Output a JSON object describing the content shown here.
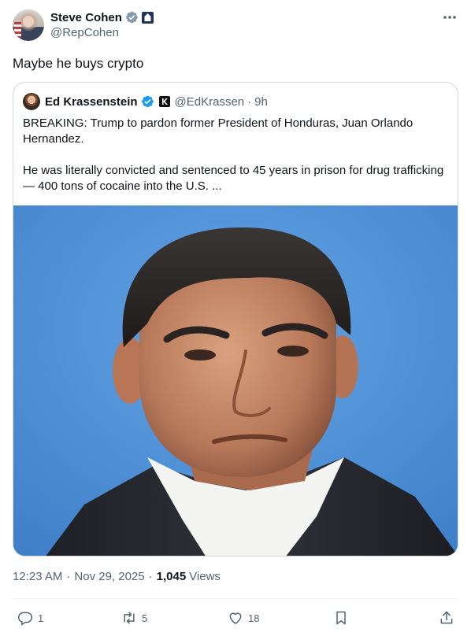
{
  "author": {
    "display_name": "Steve Cohen",
    "handle": "@RepCohen"
  },
  "tweet": {
    "text": "Maybe he buys crypto"
  },
  "quote": {
    "display_name": "Ed Krassenstein",
    "handle": "@EdKrassen",
    "separator": "·",
    "time": "9h",
    "paragraph_1": "BREAKING: Trump to pardon former President of Honduras, Juan Orlando Hernandez.",
    "paragraph_2": "He was literally convicted and sentenced to 45 years in prison for drug trafficking — 400 tons of cocaine into the U.S. ..."
  },
  "meta": {
    "time": "12:23 AM",
    "separator": "·",
    "date": "Nov 29, 2025",
    "views_count": "1,045",
    "views_label": "Views"
  },
  "actions": {
    "replies": "1",
    "reposts": "5",
    "likes": "18"
  },
  "colors": {
    "verified_blue": "#1d9bf0",
    "secondary_text": "#536471",
    "primary_text": "#0f1419",
    "border": "#cfd9de",
    "photo_background": "#4d8fd6"
  },
  "icons": [
    "verified-badge-icon",
    "government-badge-icon",
    "more-icon",
    "reply-icon",
    "repost-icon",
    "like-icon",
    "bookmark-icon",
    "share-icon"
  ]
}
